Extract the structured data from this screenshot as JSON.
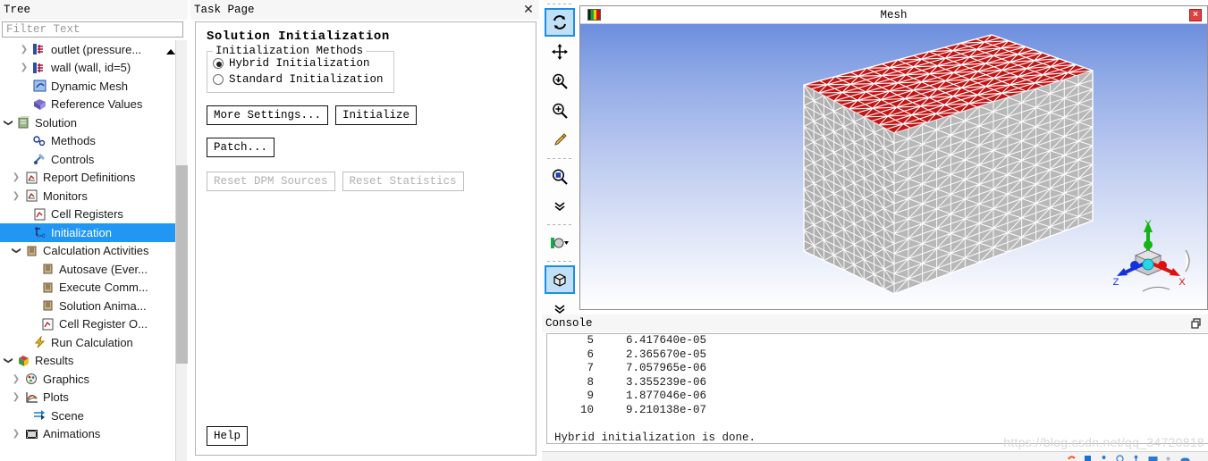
{
  "tree": {
    "title": "Tree",
    "filter_placeholder": "Filter Text",
    "items": [
      {
        "label": "outlet (pressure...",
        "indent": 2,
        "twisty": "right",
        "icon": "boundary-icon"
      },
      {
        "label": "wall (wall, id=5)",
        "indent": 2,
        "twisty": "right",
        "icon": "boundary-icon"
      },
      {
        "label": "Dynamic Mesh",
        "indent": 2,
        "twisty": "none",
        "icon": "dynamic-mesh-icon"
      },
      {
        "label": "Reference Values",
        "indent": 2,
        "twisty": "none",
        "icon": "reference-values-icon"
      },
      {
        "label": "Solution",
        "indent": 0,
        "twisty": "down",
        "icon": "solution-icon"
      },
      {
        "label": "Methods",
        "indent": 2,
        "twisty": "none",
        "icon": "methods-icon"
      },
      {
        "label": "Controls",
        "indent": 2,
        "twisty": "none",
        "icon": "controls-icon"
      },
      {
        "label": "Report Definitions",
        "indent": 1,
        "twisty": "right",
        "icon": "report-icon"
      },
      {
        "label": "Monitors",
        "indent": 1,
        "twisty": "right",
        "icon": "monitors-icon"
      },
      {
        "label": "Cell Registers",
        "indent": 2,
        "twisty": "none",
        "icon": "cell-registers-icon"
      },
      {
        "label": "Initialization",
        "indent": 2,
        "twisty": "none",
        "icon": "initialization-icon",
        "selected": true
      },
      {
        "label": "Calculation Activities",
        "indent": 1,
        "twisty": "down",
        "icon": "calc-activities-icon"
      },
      {
        "label": "Autosave (Ever...",
        "indent": 3,
        "twisty": "none",
        "icon": "autosave-icon"
      },
      {
        "label": "Execute Comm...",
        "indent": 3,
        "twisty": "none",
        "icon": "execute-commands-icon"
      },
      {
        "label": "Solution Anima...",
        "indent": 3,
        "twisty": "none",
        "icon": "solution-animation-icon"
      },
      {
        "label": "Cell Register O...",
        "indent": 3,
        "twisty": "none",
        "icon": "cell-register-operation-icon"
      },
      {
        "label": "Run Calculation",
        "indent": 2,
        "twisty": "none",
        "icon": "run-calculation-icon"
      },
      {
        "label": "Results",
        "indent": 0,
        "twisty": "down",
        "icon": "results-icon"
      },
      {
        "label": "Graphics",
        "indent": 1,
        "twisty": "right",
        "icon": "graphics-icon"
      },
      {
        "label": "Plots",
        "indent": 1,
        "twisty": "right",
        "icon": "plots-icon"
      },
      {
        "label": "Scene",
        "indent": 2,
        "twisty": "none",
        "icon": "scene-icon"
      },
      {
        "label": "Animations",
        "indent": 1,
        "twisty": "right",
        "icon": "animations-icon"
      }
    ]
  },
  "task_page": {
    "title": "Task Page",
    "close_label": "✕",
    "heading": "Solution Initialization",
    "group": {
      "legend": "Initialization Methods",
      "options": [
        {
          "label": "Hybrid  Initialization",
          "selected": true
        },
        {
          "label": "Standard Initialization",
          "selected": false
        }
      ]
    },
    "buttons": {
      "more_settings": "More Settings...",
      "initialize": "Initialize",
      "patch": "Patch...",
      "reset_dpm_sources": "Reset DPM Sources",
      "reset_statistics": "Reset Statistics",
      "help": "Help"
    }
  },
  "graphics": {
    "window_title": "Mesh",
    "close_label": "×",
    "toolbar": [
      {
        "name": "rotate-tool",
        "active": true
      },
      {
        "name": "pan-tool",
        "active": false
      },
      {
        "name": "zoom-out-tool",
        "active": false
      },
      {
        "name": "zoom-in-tool",
        "active": false
      },
      {
        "name": "probe-tool",
        "active": false
      },
      {
        "name": "fit-to-window-tool",
        "active": false
      },
      {
        "name": "more-view-tools",
        "active": false
      },
      {
        "name": "display-options-tool",
        "active": false
      },
      {
        "name": "render-view-tool",
        "active": true
      },
      {
        "name": "more-render-tools",
        "active": false
      }
    ],
    "axes": [
      {
        "label": "X",
        "color": "#e01010"
      },
      {
        "label": "Y",
        "color": "#14b414"
      },
      {
        "label": "Z",
        "color": "#1430e0"
      }
    ],
    "mesh": {
      "top_face_color": "#c21515",
      "side_face_color": "#b4b4b4",
      "edge_color": "#ffffff"
    }
  },
  "console": {
    "title": "Console",
    "restore_icon": "restore-window-icon",
    "rows": [
      {
        "iteration": "5",
        "residual": "6.417640e-05"
      },
      {
        "iteration": "6",
        "residual": "2.365670e-05"
      },
      {
        "iteration": "7",
        "residual": "7.057965e-06"
      },
      {
        "iteration": "8",
        "residual": "3.355239e-06"
      },
      {
        "iteration": "9",
        "residual": "1.877046e-06"
      },
      {
        "iteration": "10",
        "residual": "9.210138e-07"
      }
    ],
    "message": "Hybrid initialization is done."
  },
  "watermark": "https://blog.csdn.net/qq_34720818"
}
